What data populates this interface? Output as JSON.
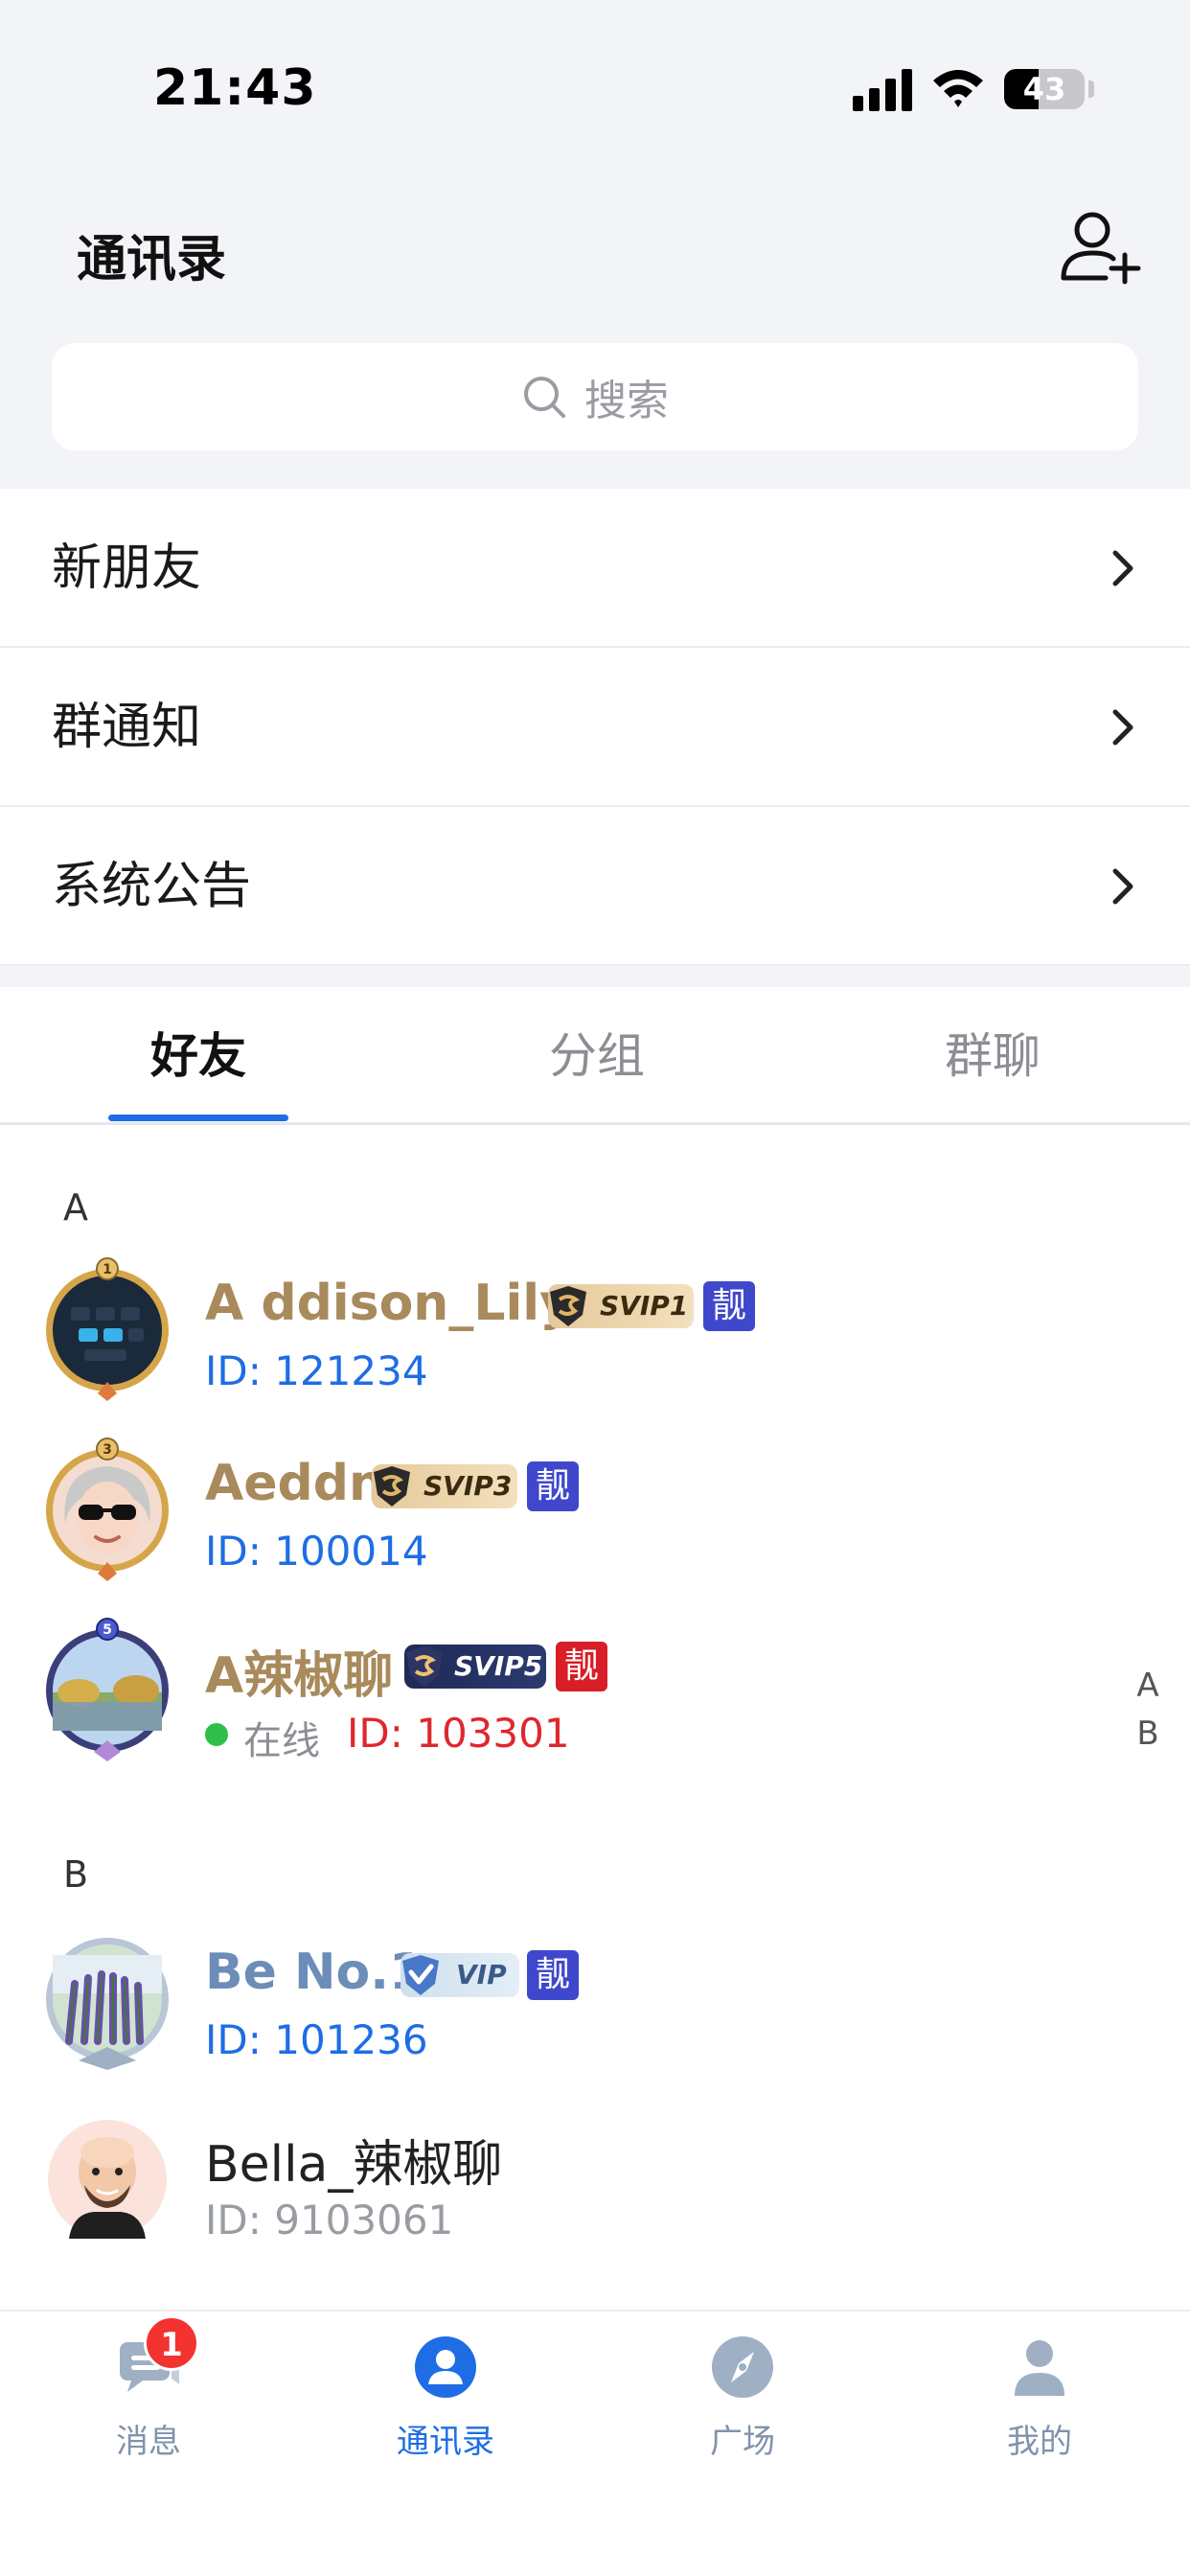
{
  "status_bar": {
    "time": "21:43",
    "battery": "43",
    "battery_level_percent": 43
  },
  "header": {
    "title": "通讯录",
    "add_friend_icon": "add-user-icon"
  },
  "search": {
    "placeholder": "搜索"
  },
  "menu": [
    {
      "label": "新朋友"
    },
    {
      "label": "群通知"
    },
    {
      "label": "系统公告"
    }
  ],
  "tabs": [
    {
      "label": "好友",
      "active": true
    },
    {
      "label": "分组",
      "active": false
    },
    {
      "label": "群聊",
      "active": false
    }
  ],
  "sections": [
    {
      "letter": "A"
    },
    {
      "letter": "B"
    }
  ],
  "contacts": [
    {
      "name": "A ddison_Lily",
      "badge": "SVIP1",
      "liang": "靓",
      "id": "ID: 121234",
      "name_color": "#a88a5c",
      "id_color": "#1e6de5"
    },
    {
      "name": "Aeddn",
      "badge": "SVIP3",
      "liang": "靓",
      "id": "ID: 100014",
      "name_color": "#a88a5c",
      "id_color": "#1e6de5"
    },
    {
      "name": "A辣椒聊",
      "badge": "SVIP5",
      "liang": "靓",
      "status": "在线",
      "id": "ID: 103301",
      "name_color": "#a88a5c",
      "id_color": "#e0262d"
    },
    {
      "name": "Be No.1",
      "badge": "VIP",
      "liang": "靓",
      "id": "ID: 101236",
      "name_color": "#6b8db8",
      "id_color": "#1e6de5"
    },
    {
      "name": "Bella_辣椒聊",
      "id": "ID: 9103061",
      "name_color": "#222222",
      "id_color": "#9a9ca3"
    }
  ],
  "index_bar": [
    "A",
    "B"
  ],
  "bottom_nav": [
    {
      "label": "消息",
      "icon": "chat-icon",
      "badge": "1",
      "active": false
    },
    {
      "label": "通讯录",
      "icon": "contacts-icon",
      "active": true
    },
    {
      "label": "广场",
      "icon": "compass-icon",
      "active": false
    },
    {
      "label": "我的",
      "icon": "profile-icon",
      "active": false
    }
  ],
  "colors": {
    "accent": "#1e6de5",
    "background": "#f3f4f8",
    "nav_inactive": "#8fa1b8",
    "badge_red": "#f2332f"
  }
}
